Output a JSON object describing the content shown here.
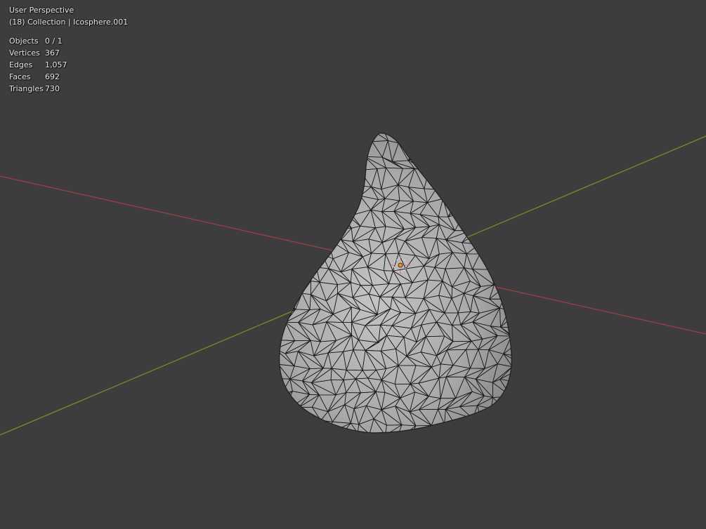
{
  "viewport": {
    "view_name": "User Perspective",
    "context": "(18) Collection | Icosphere.001",
    "background_color": "#3d3d3d"
  },
  "stats": [
    {
      "label": "Objects",
      "value": "0 / 1"
    },
    {
      "label": "Vertices",
      "value": "367"
    },
    {
      "label": "Edges",
      "value": "1,057"
    },
    {
      "label": "Faces",
      "value": "692"
    },
    {
      "label": "Triangles",
      "value": "730"
    }
  ],
  "colors": {
    "x_axis": "#9a3f48",
    "y_axis": "#6e8f2a",
    "mesh_fill": "#a9a9ab",
    "mesh_wire": "#1a1a1a",
    "origin_marker": "#f08a1c"
  },
  "icons": {
    "origin": "object-origin-icon",
    "mesh": "icosphere-mesh"
  }
}
